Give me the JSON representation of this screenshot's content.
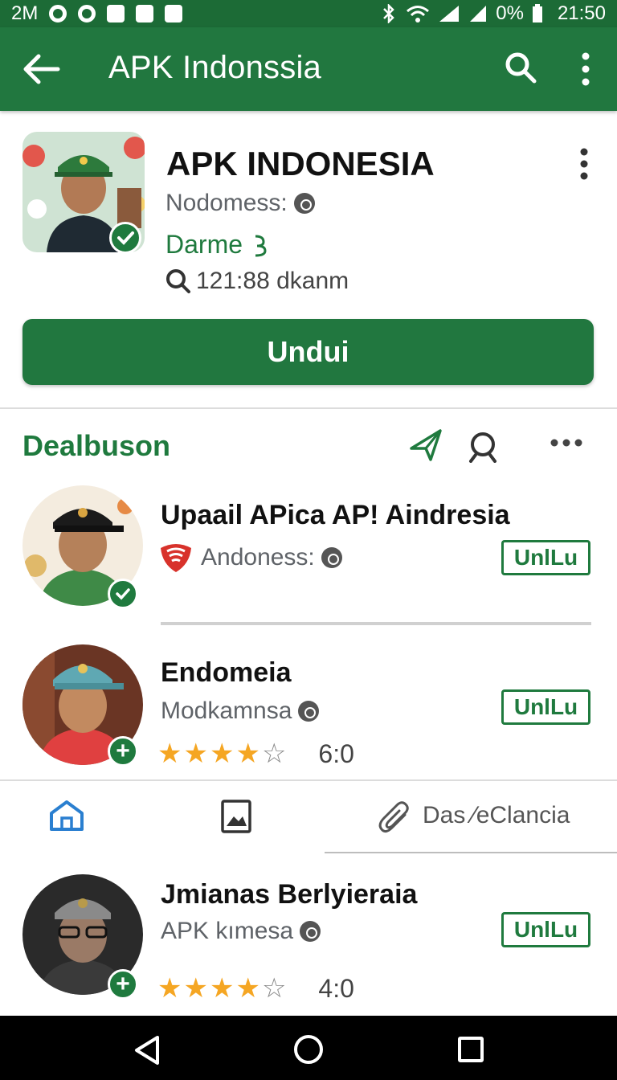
{
  "status_bar": {
    "left_text": "2M",
    "battery": "0%",
    "time": "21:50"
  },
  "app_bar": {
    "title": "APK Indonssia",
    "icons": [
      "back-arrow-icon",
      "search-icon",
      "more-vert-icon"
    ]
  },
  "hero": {
    "title": "APK INDONESIA",
    "publisher": "Nodomess:",
    "tag": "Darme",
    "stat": "121:88 dkanm",
    "download_label": "Undui"
  },
  "section": {
    "title": "Dealbuson"
  },
  "items": [
    {
      "title": "Upaail APica AP! Aindresia",
      "subtitle": "Andoness:",
      "button": "UnlLu",
      "badge": "check"
    },
    {
      "title": "Endomeia",
      "subtitle": "Modkamnsa",
      "button": "UnlLu",
      "badge": "+",
      "rating_value": "6:0",
      "stars": 4
    },
    {
      "title": "Jmianas Berlyieraia",
      "subtitle": "APK kımesa",
      "button": "UnlLu",
      "badge": "+",
      "rating_value": "4:0",
      "stars": 4
    }
  ],
  "tabs": {
    "third_label": "Das ∕eClancia"
  },
  "colors": {
    "primary": "#21773f",
    "status_bar": "#1c6b36",
    "star": "#f5a623"
  }
}
